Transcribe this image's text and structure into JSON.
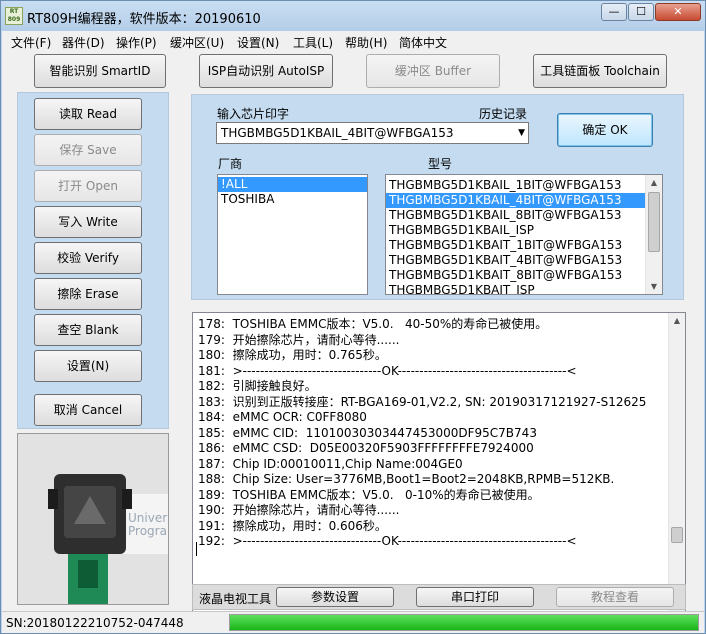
{
  "window": {
    "title": "RT809H编程器，软件版本：20190610",
    "icon_text": "RT809H"
  },
  "window_buttons": {
    "minimize": "—",
    "maximize": "☐",
    "close": "✕"
  },
  "menu": [
    "文件(F)",
    "器件(D)",
    "操作(P)",
    "缓冲区(U)",
    "设置(N)",
    "工具(L)",
    "帮助(H)",
    "简体中文"
  ],
  "toolbar": {
    "smartid": "智能识别 SmartID",
    "autoisp": "ISP自动识别 AutoISP",
    "buffer": "缓冲区 Buffer",
    "toolchain": "工具链面板 Toolchain"
  },
  "side_buttons": {
    "read": "读取 Read",
    "save": "保存 Save",
    "open": "打开 Open",
    "write": "写入 Write",
    "verify": "校验 Verify",
    "erase": "擦除 Erase",
    "blank": "查空 Blank",
    "settings": "设置(N)",
    "cancel": "取消 Cancel"
  },
  "chip": {
    "input_label": "输入芯片印字",
    "history_label": "历史记录",
    "input_value": "THGBMBG5D1KBAIL_4BIT@WFBGA153",
    "confirm": "确定 OK",
    "vendor_label": "厂商",
    "model_label": "型号",
    "vendors": [
      "!ALL",
      "TOSHIBA"
    ],
    "vendor_selected": 0,
    "models": [
      "THGBMBG5D1KBAIL_1BIT@WFBGA153",
      "THGBMBG5D1KBAIL_4BIT@WFBGA153",
      "THGBMBG5D1KBAIL_8BIT@WFBGA153",
      "THGBMBG5D1KBAIL_ISP",
      "THGBMBG5D1KBAIT_1BIT@WFBGA153",
      "THGBMBG5D1KBAIT_4BIT@WFBGA153",
      "THGBMBG5D1KBAIT_8BIT@WFBGA153",
      "THGBMBG5D1KBAIT_ISP"
    ],
    "model_selected": 1
  },
  "log": [
    "178:  TOSHIBA EMMC版本：V5.0.   40-50%的寿命已被使用。",
    "179:  开始擦除芯片，请耐心等待......",
    "180:  擦除成功，用时：0.765秒。",
    "181:  >--------------------------------OK---------------------------------------<",
    "182:  引脚接触良好。",
    "183:  识别到正版转接座：RT-BGA169-01,V2.2, SN: 20190317121927-S12625",
    "184:  eMMC OCR: C0FF8080",
    "185:  eMMC CID:  11010030303447453000DF95C7B743",
    "186:  eMMC CSD:  D05E00320F5903FFFFFFFFE7924000",
    "187:  Chip ID:00010011,Chip Name:004GE0",
    "188:  Chip Size: User=3776MB,Boot1=Boot2=2048KB,RPMB=512KB.",
    "189:  TOSHIBA EMMC版本：V5.0.   0-10%的寿命已被使用。",
    "190:  开始擦除芯片，请耐心等待......",
    "191:  擦除成功，用时：0.606秒。",
    "192:  >--------------------------------OK---------------------------------------<"
  ],
  "photo_text": "Univer Progra",
  "bottom": {
    "lcd_label": "液晶电视工具",
    "params": "参数设置",
    "serial": "串口打印",
    "tutorial": "教程查看"
  },
  "status": {
    "sn": "SN:20180122210752-047448",
    "progress": 1.0,
    "progress_color": "#22bb22"
  }
}
